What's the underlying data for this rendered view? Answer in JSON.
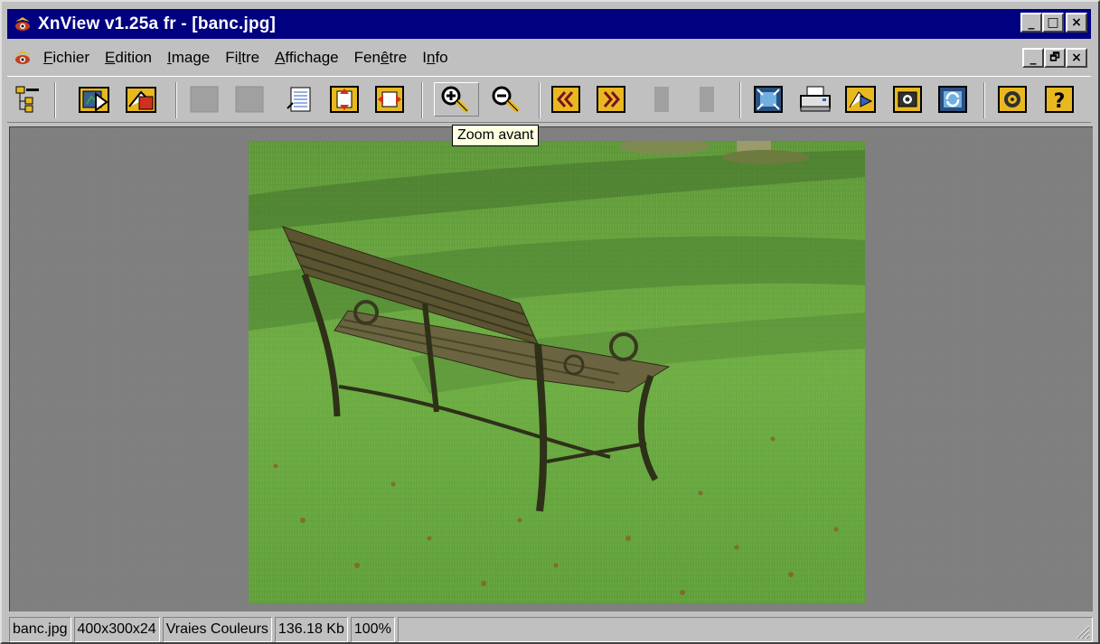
{
  "window": {
    "title": "XnView v1.25a fr - [banc.jpg]",
    "title_buttons": [
      "_",
      "□",
      "×"
    ],
    "mdi_buttons": [
      "_",
      "🗗",
      "×"
    ]
  },
  "menu": [
    {
      "label": "Fichier",
      "accel": "F",
      "rest": "ichier"
    },
    {
      "label": "Edition",
      "accel": "E",
      "rest": "dition"
    },
    {
      "label": "Image",
      "accel": "I",
      "rest": "mage"
    },
    {
      "label": "Filtre",
      "accel": "",
      "pre": "Fi",
      "accel2": "l",
      "rest": "tre"
    },
    {
      "label": "Affichage",
      "accel": "A",
      "rest": "ffichage"
    },
    {
      "label": "Fenêtre",
      "accel": "",
      "pre": "Fen",
      "accel2": "ê",
      "rest": "tre"
    },
    {
      "label": "Info",
      "accel": "",
      "pre": "I",
      "accel2": "n",
      "rest": "fo"
    }
  ],
  "toolbar": {
    "icons": [
      "browser-tree-icon",
      "open-file-icon",
      "save-file-icon",
      "disabled-button-icon",
      "disabled-button-icon",
      "properties-icon",
      "flip-vertical-icon",
      "flip-horizontal-icon",
      "zoom-in-icon",
      "zoom-out-icon",
      "previous-image-icon",
      "next-image-icon",
      "disabled-button-icon",
      "disabled-button-icon",
      "fullscreen-icon",
      "print-icon",
      "convert-icon",
      "capture-icon",
      "refresh-icon",
      "settings-icon",
      "help-icon"
    ],
    "tooltip": "Zoom avant"
  },
  "image": {
    "name": "banc.jpg",
    "description_colors": {
      "grass": "#6aa640",
      "shadow": "#4a7a32",
      "bench": "#5a5530"
    }
  },
  "status": {
    "filename": "banc.jpg",
    "dimensions": "400x300x24",
    "color_mode": "Vraies Couleurs",
    "file_size": "136.18 Kb",
    "zoom": "100%"
  },
  "colors": {
    "titlebar": "#000080",
    "chrome": "#c0c0c0",
    "workspace": "#808080",
    "icon_yellow": "#e8b820"
  }
}
